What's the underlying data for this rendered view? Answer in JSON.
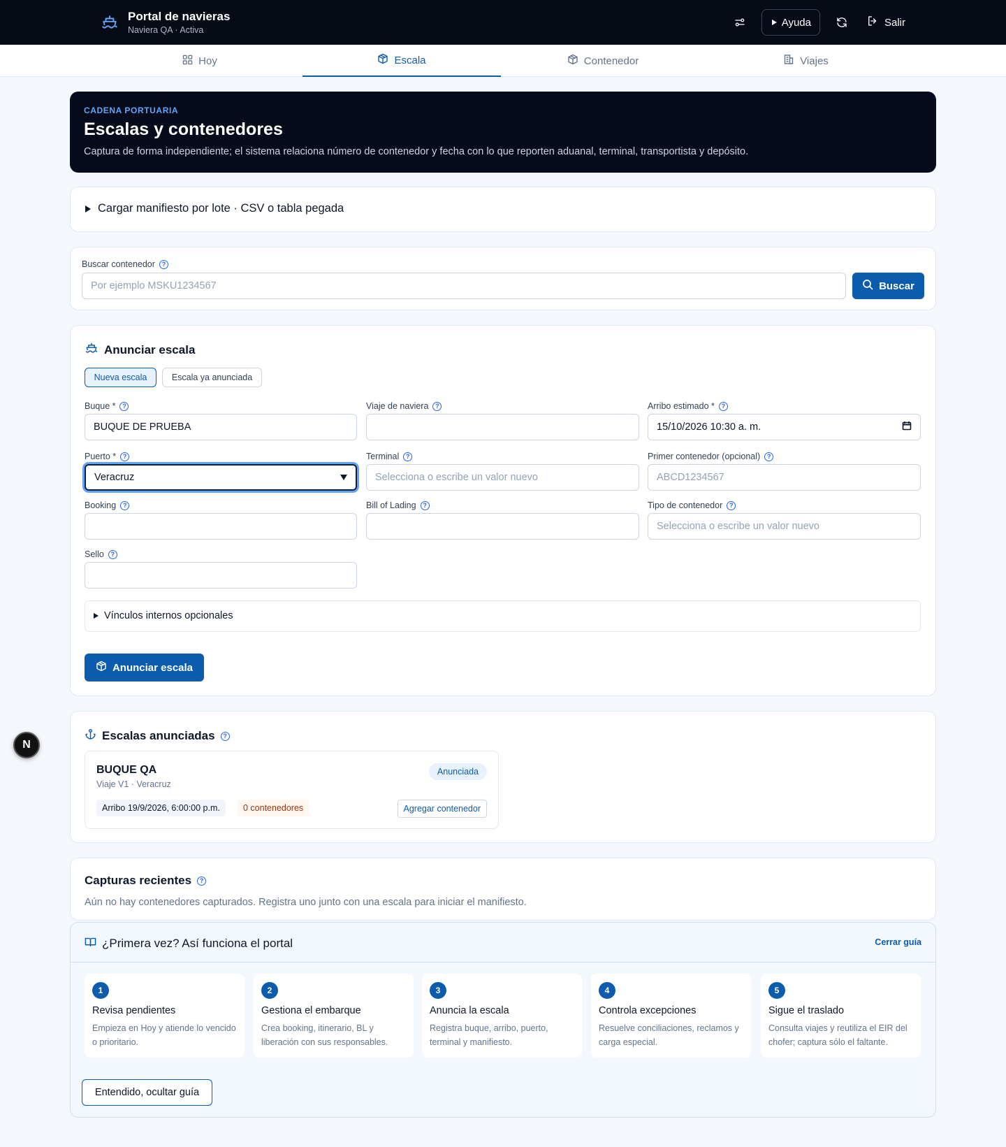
{
  "header": {
    "title": "Portal de navieras",
    "subtitle": "Naviera QA · Activa",
    "help_label": "Ayuda",
    "logout_label": "Salir"
  },
  "tabs": [
    {
      "label": "Hoy",
      "icon": "grid-icon",
      "active": false
    },
    {
      "label": "Escala",
      "icon": "box-icon",
      "active": true
    },
    {
      "label": "Contenedor",
      "icon": "box-icon",
      "active": false
    },
    {
      "label": "Viajes",
      "icon": "building-icon",
      "active": false
    }
  ],
  "hero": {
    "kicker": "CADENA PORTUARIA",
    "title": "Escalas y contenedores",
    "description": "Captura de forma independiente; el sistema relaciona número de contenedor y fecha con lo que reporten aduanal, terminal, transportista y depósito."
  },
  "batch": {
    "label": "Cargar manifiesto por lote · CSV o tabla pegada"
  },
  "search": {
    "label": "Buscar contenedor",
    "placeholder": "Por ejemplo MSKU1234567",
    "button": "Buscar"
  },
  "announce": {
    "title": "Anunciar escala",
    "mode_new": "Nueva escala",
    "mode_existing": "Escala ya anunciada",
    "fields": {
      "buque": {
        "label": "Buque *",
        "value": "BUQUE DE PRUEBA"
      },
      "viaje": {
        "label": "Viaje de naviera",
        "value": ""
      },
      "arribo": {
        "label": "Arribo estimado *",
        "value": "15/10/2026 10:30 a. m."
      },
      "puerto": {
        "label": "Puerto *",
        "value": "Veracruz"
      },
      "terminal": {
        "label": "Terminal",
        "placeholder": "Selecciona o escribe un valor nuevo"
      },
      "primer": {
        "label": "Primer contenedor (opcional)",
        "placeholder": "ABCD1234567"
      },
      "booking": {
        "label": "Booking",
        "value": ""
      },
      "bl": {
        "label": "Bill of Lading",
        "value": ""
      },
      "tipo": {
        "label": "Tipo de contenedor",
        "placeholder": "Selecciona o escribe un valor nuevo"
      },
      "sello": {
        "label": "Sello",
        "value": ""
      }
    },
    "links_label": "Vínculos internos opcionales",
    "submit": "Anunciar escala"
  },
  "announced": {
    "title": "Escalas anunciadas",
    "item": {
      "ship": "BUQUE QA",
      "meta": "Viaje V1 · Veracruz",
      "status": "Anunciada",
      "arrival": "Arribo 19/9/2026, 6:00:00 p.m.",
      "containers": "0 contenedores",
      "add": "Agregar contenedor"
    }
  },
  "recent": {
    "title": "Capturas recientes",
    "empty": "Aún no hay contenedores capturados. Registra uno junto con una escala para iniciar el manifiesto."
  },
  "guide": {
    "title": "¿Primera vez? Así funciona el portal",
    "close": "Cerrar guía",
    "steps": [
      {
        "num": "1",
        "title": "Revisa pendientes",
        "desc": "Empieza en Hoy y atiende lo vencido o prioritario."
      },
      {
        "num": "2",
        "title": "Gestiona el embarque",
        "desc": "Crea booking, itinerario, BL y liberación con sus responsables."
      },
      {
        "num": "3",
        "title": "Anuncia la escala",
        "desc": "Registra buque, arribo, puerto, terminal y manifiesto."
      },
      {
        "num": "4",
        "title": "Controla excepciones",
        "desc": "Resuelve conciliaciones, reclamos y carga especial."
      },
      {
        "num": "5",
        "title": "Sigue el traslado",
        "desc": "Consulta viajes y reutiliza el EIR del chofer; captura sólo el faltante."
      }
    ],
    "dismiss": "Entendido, ocultar guía"
  },
  "fab": {
    "label": "N"
  },
  "colors": {
    "primary": "#0b5cad",
    "header_bg": "#070b16",
    "hero_bg": "#050b1a",
    "page_bg": "#f4f7fb"
  }
}
